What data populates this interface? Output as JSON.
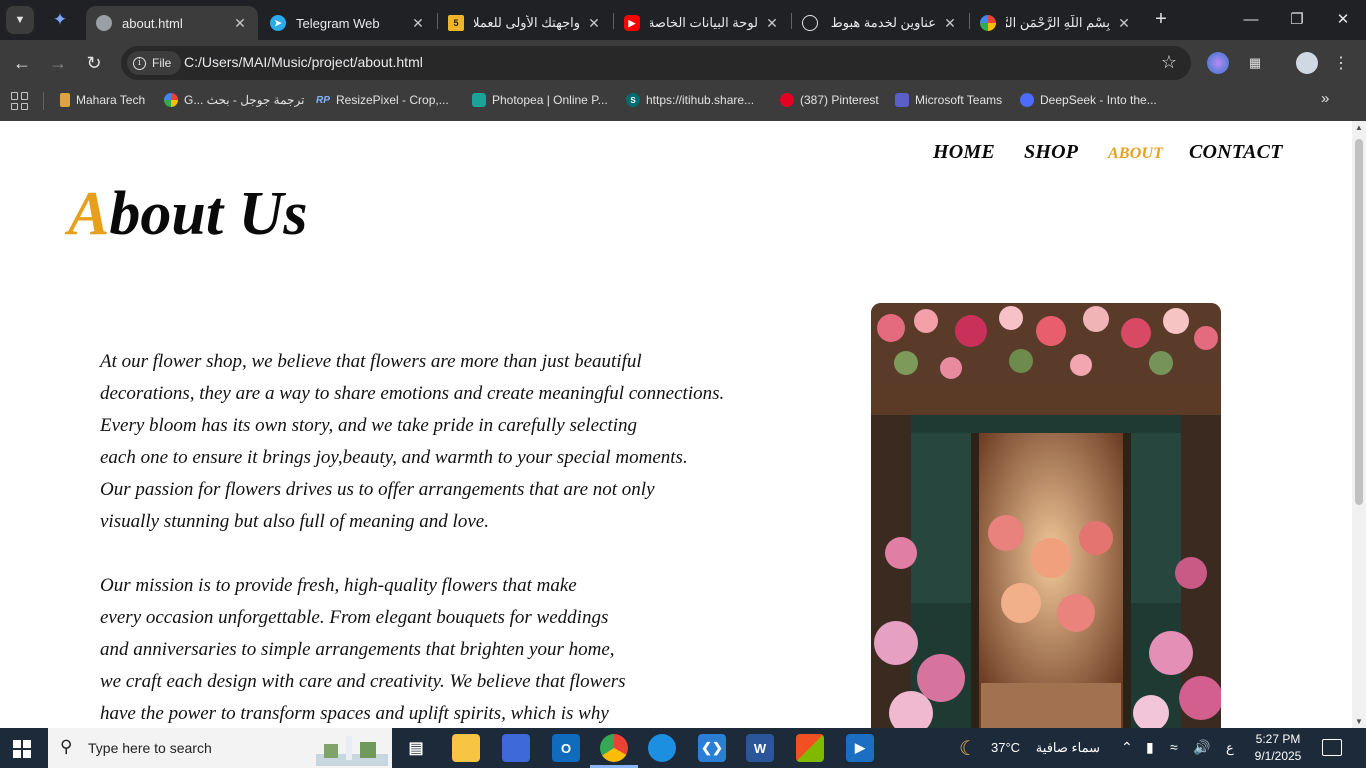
{
  "browser": {
    "tabs": [
      {
        "title": "about.html",
        "active": true
      },
      {
        "title": "Telegram Web"
      },
      {
        "title": "واجهتك الأولى للعملاء"
      },
      {
        "title": "لوحة البيانات الخاصة"
      },
      {
        "title": "عناوين لخدمة هبوط"
      },
      {
        "title": "بِسْمِ اللَّهِ الرَّحْمَنِ الرَّحِيم"
      }
    ],
    "tab_badge_5": "5",
    "address_chip": "File",
    "url": "C:/Users/MAI/Music/project/about.html",
    "bookmarks": [
      "Mahara Tech",
      "G... ترجمة جوجل - بحث",
      "ResizePixel - Crop,...",
      "Photopea | Online P...",
      "https://itihub.share...",
      "(387) Pinterest",
      "Microsoft Teams",
      "DeepSeek - Into the..."
    ],
    "bookmark_badges": {
      "resizepixel": "RP",
      "itihub": "S"
    }
  },
  "page": {
    "nav": [
      "HOME",
      "SHOP",
      "ABOUT",
      "CONTACT"
    ],
    "active_nav": "ABOUT",
    "title_first_letter": "A",
    "title_rest": "bout Us",
    "paragraph1": [
      "At our flower shop, we believe that flowers are more than just beautiful",
      "decorations, they are a way to share emotions and create meaningful connections.",
      "Every bloom has its own story, and we take pride in carefully selecting",
      "each one to ensure it brings joy,beauty, and warmth to your special moments.",
      "Our passion for flowers drives us to offer arrangements that are not only",
      "visually stunning but also full of meaning and love."
    ],
    "paragraph2": [
      "Our mission is to provide fresh, high-quality flowers that make",
      "every occasion unforgettable. From elegant bouquets for weddings",
      "and anniversaries to simple arrangements that brighten your home,",
      "we craft each design with care and creativity. We believe that flowers",
      "have the power to transform spaces and uplift spirits, which is why"
    ],
    "accent_color": "#e8a01c"
  },
  "taskbar": {
    "search_placeholder": "Type here to search",
    "outlook_letter": "O",
    "word_letter": "W",
    "temperature": "37°C",
    "weather": "سماء صافية",
    "input_lang": "ع",
    "time": "5:27 PM",
    "date": "9/1/2025"
  }
}
